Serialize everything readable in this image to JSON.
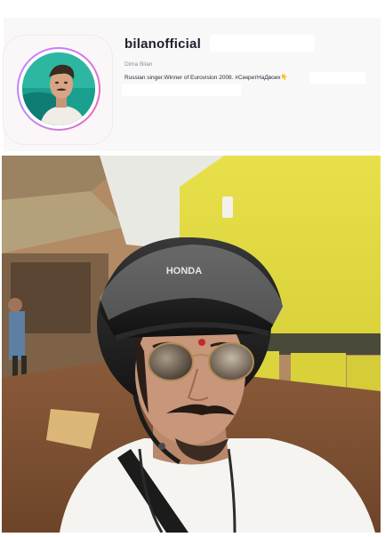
{
  "profile": {
    "username": "bilanofficial",
    "full_name": "Dima Bilan",
    "bio": "Russian singer.Winner of Eurovision 2008. #СекретНаДвоих👇"
  },
  "post": {
    "helmet_brand": "HONDA"
  },
  "icons": {
    "avatar": "profile-photo",
    "photo": "post-photo"
  }
}
